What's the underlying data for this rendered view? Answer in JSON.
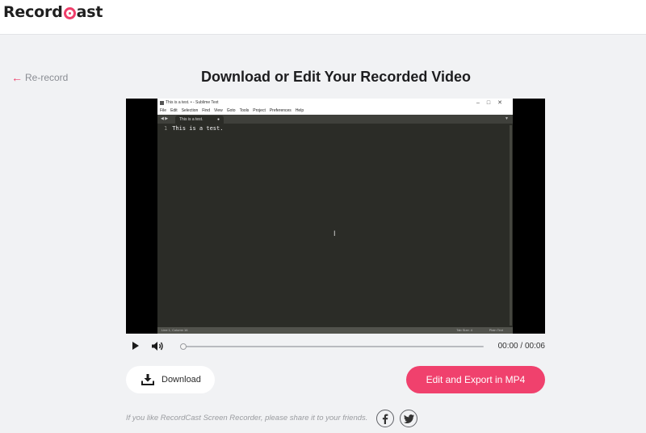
{
  "header": {
    "logo_text_before": "Record",
    "logo_text_after": "ast",
    "accent_color": "#ef3e6a"
  },
  "page": {
    "back_label": "Re-record",
    "title": "Download or Edit Your Recorded Video"
  },
  "video_frame": {
    "window_title": "This is a test. • - Sublime Text",
    "menu": [
      "File",
      "Edit",
      "Selection",
      "Find",
      "View",
      "Goto",
      "Tools",
      "Project",
      "Preferences",
      "Help"
    ],
    "tab_label": "This is a test.",
    "line_number": "1",
    "line_text": "This is a test.",
    "status_left": "Line 1, Column 16",
    "status_tab": "Tab Size: 4",
    "status_syntax": "Plain Text"
  },
  "player": {
    "current_time": "00:00",
    "duration": "00:06",
    "progress": 0
  },
  "actions": {
    "download_label": "Download",
    "export_label": "Edit and Export in MP4"
  },
  "footer": {
    "share_text": "If you like RecordCast Screen Recorder, please share it to your friends.",
    "social": [
      "facebook-icon",
      "twitter-icon"
    ]
  }
}
